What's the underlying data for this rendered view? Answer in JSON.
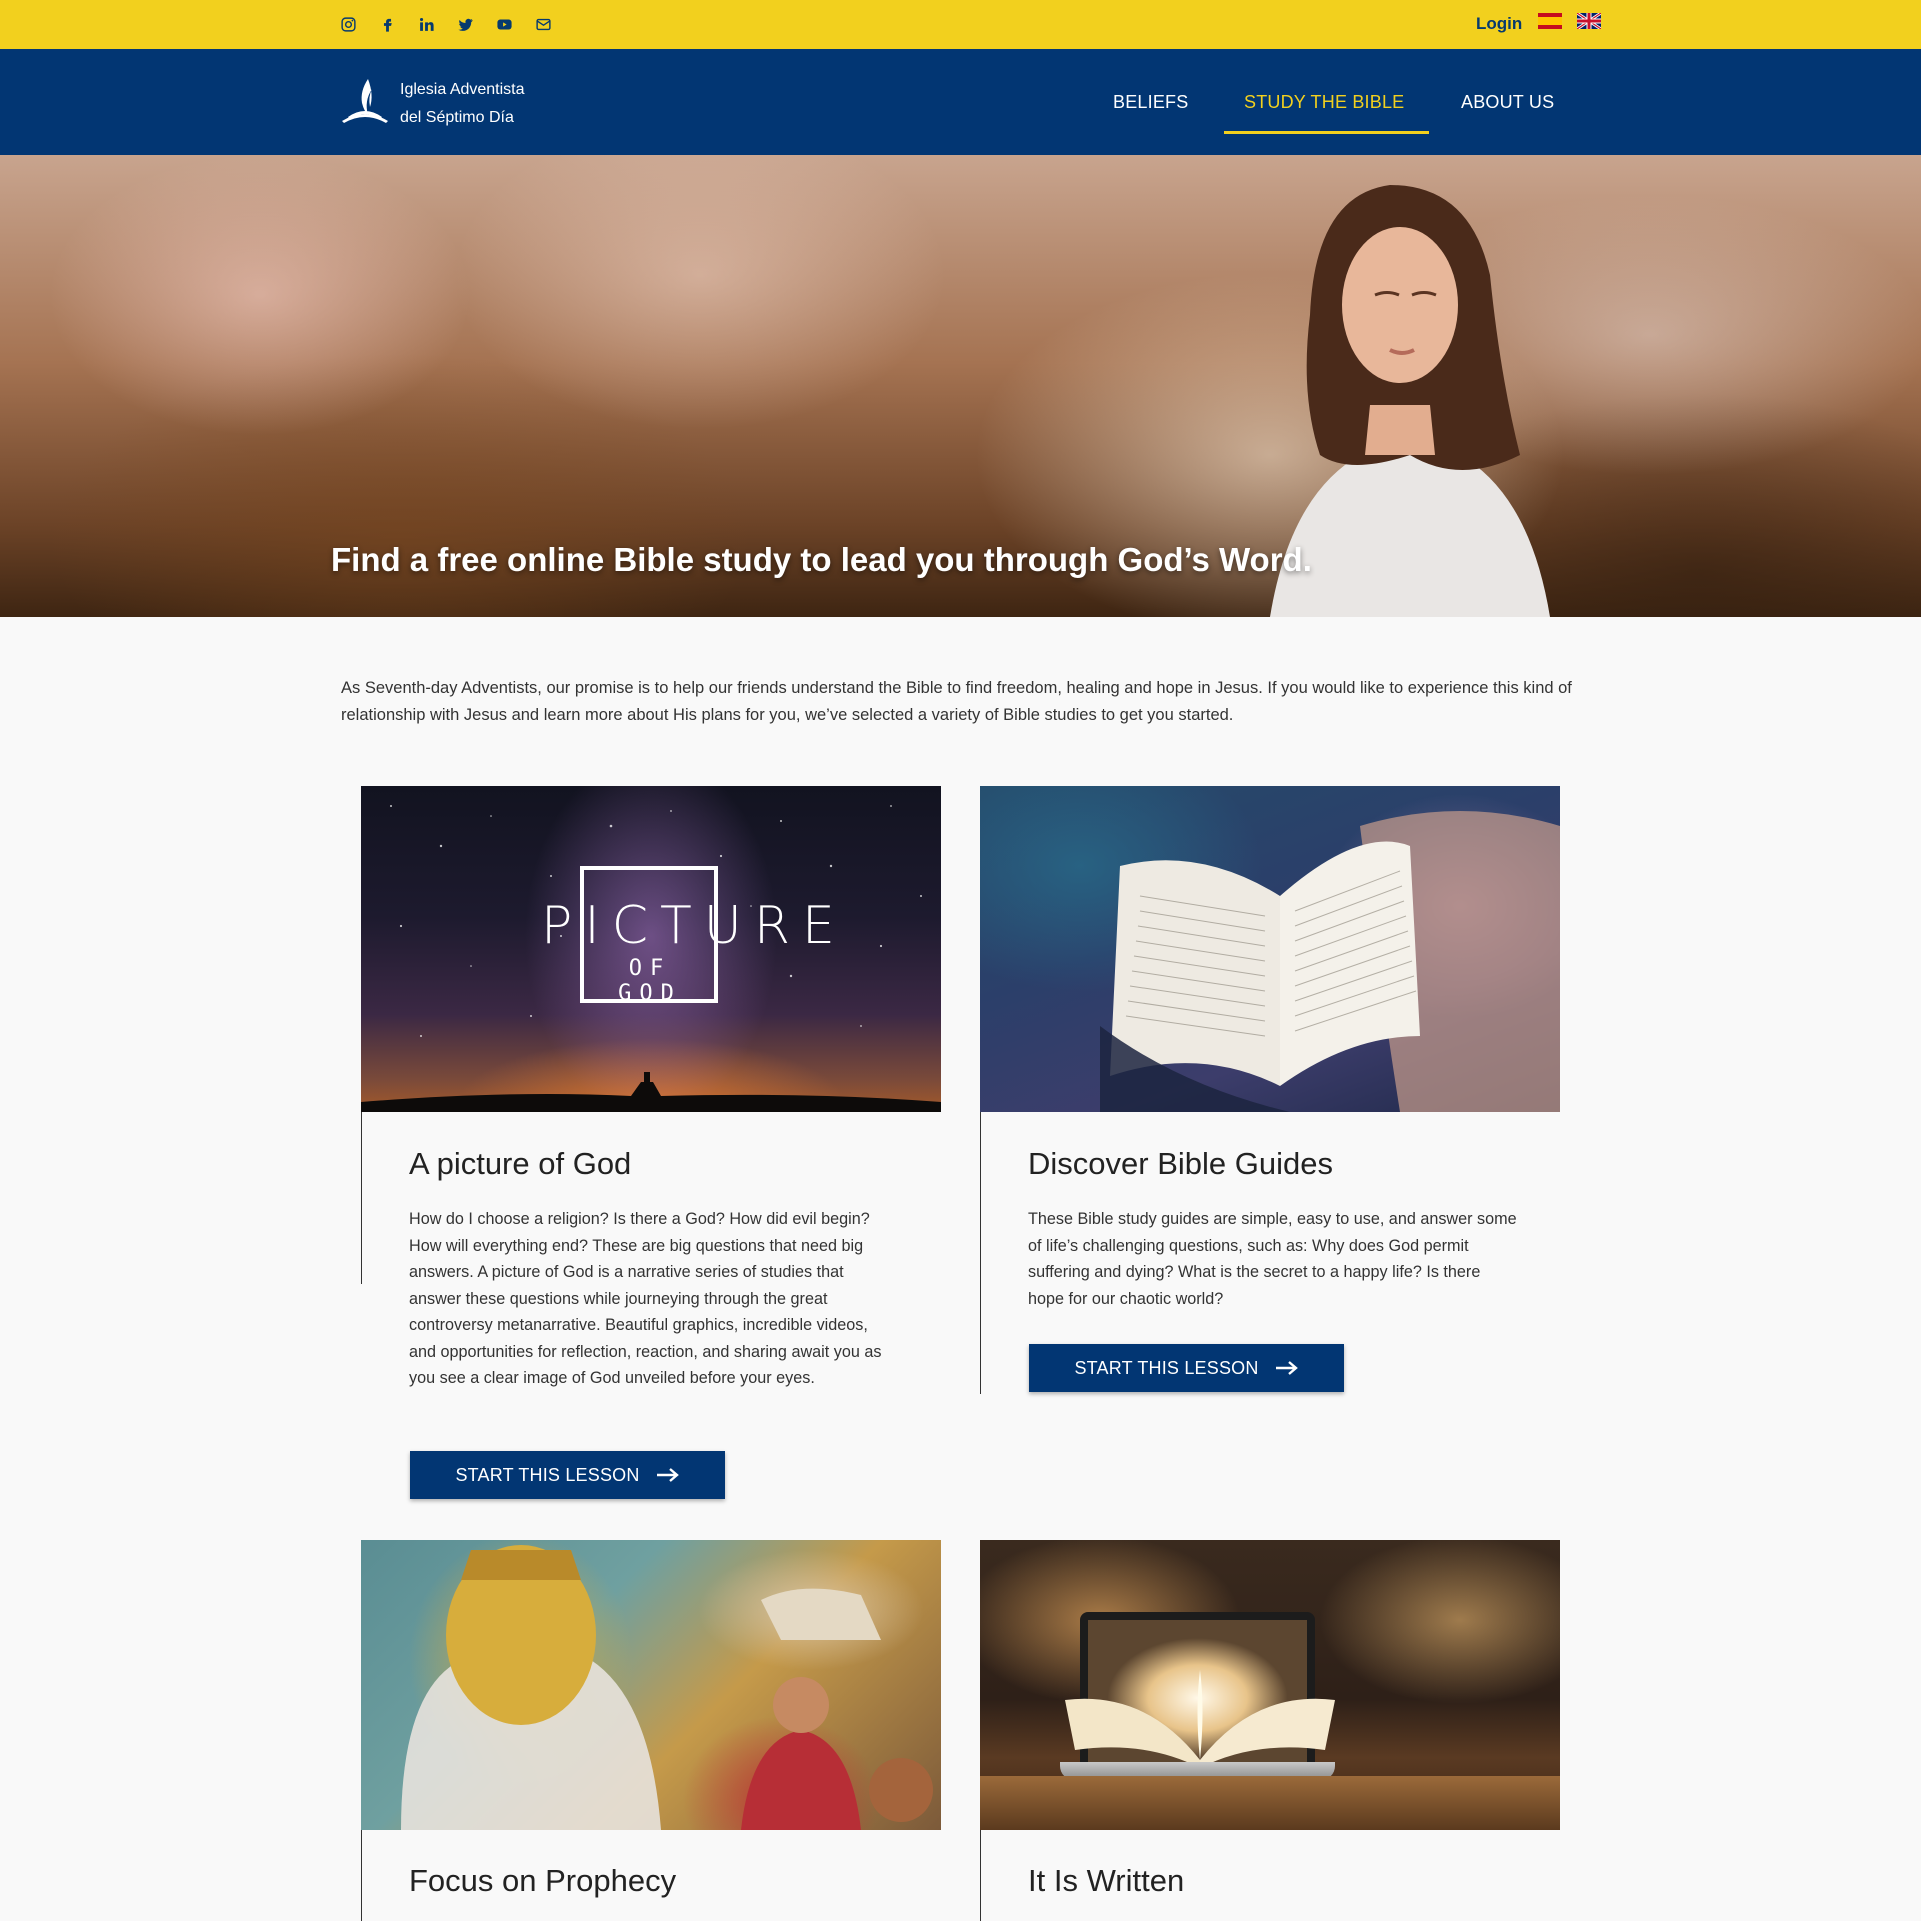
{
  "topbar": {
    "social": [
      "instagram-icon",
      "facebook-icon",
      "linkedin-icon",
      "twitter-icon",
      "youtube-icon",
      "email-icon"
    ],
    "login_label": "Login",
    "languages": [
      "es",
      "en"
    ],
    "colors": {
      "background": "#f2d01e",
      "text": "#063a6e"
    }
  },
  "nav": {
    "brand_line1": "Iglesia Adventista",
    "brand_line2": "del Séptimo Día",
    "items": [
      {
        "label": "BELIEFS",
        "active": false
      },
      {
        "label": "STUDY THE BIBLE",
        "active": true
      },
      {
        "label": "ABOUT US",
        "active": false
      }
    ],
    "colors": {
      "background": "#023673",
      "active": "#f2d01e"
    }
  },
  "hero": {
    "title": "Find a free online Bible study to lead you through God’s Word."
  },
  "intro": {
    "text": "As Seventh-day Adventists, our promise is to help our friends understand the Bible to find freedom, healing and hope in Jesus. If you would like to experience this kind of relationship with Jesus and learn more about His plans for you, we’ve selected a variety of Bible studies to get you started."
  },
  "cards": [
    {
      "title": "A picture of God",
      "image_text_main": "PICTURE",
      "image_text_sub": "OF GOD",
      "description": "How do I choose a religion? Is there a God? How did evil begin? How will everything end? These are big questions that need big answers. A picture of God is a narrative series of studies that answer these questions while journeying through the great controversy metanarrative. Beautiful graphics, incredible videos, and opportunities for reflection, reaction, and sharing await you as you see a clear image of God unveiled before your eyes.",
      "button": "START THIS LESSON"
    },
    {
      "title": "Discover Bible Guides",
      "description": "These Bible study guides are simple, easy to use, and answer some of life’s challenging questions, such as: Why does God permit suffering and dying? What is the secret to a happy life? Is there hope for our chaotic world?",
      "button": "START THIS LESSON"
    },
    {
      "title": "Focus on Prophecy"
    },
    {
      "title": "It Is Written"
    }
  ]
}
